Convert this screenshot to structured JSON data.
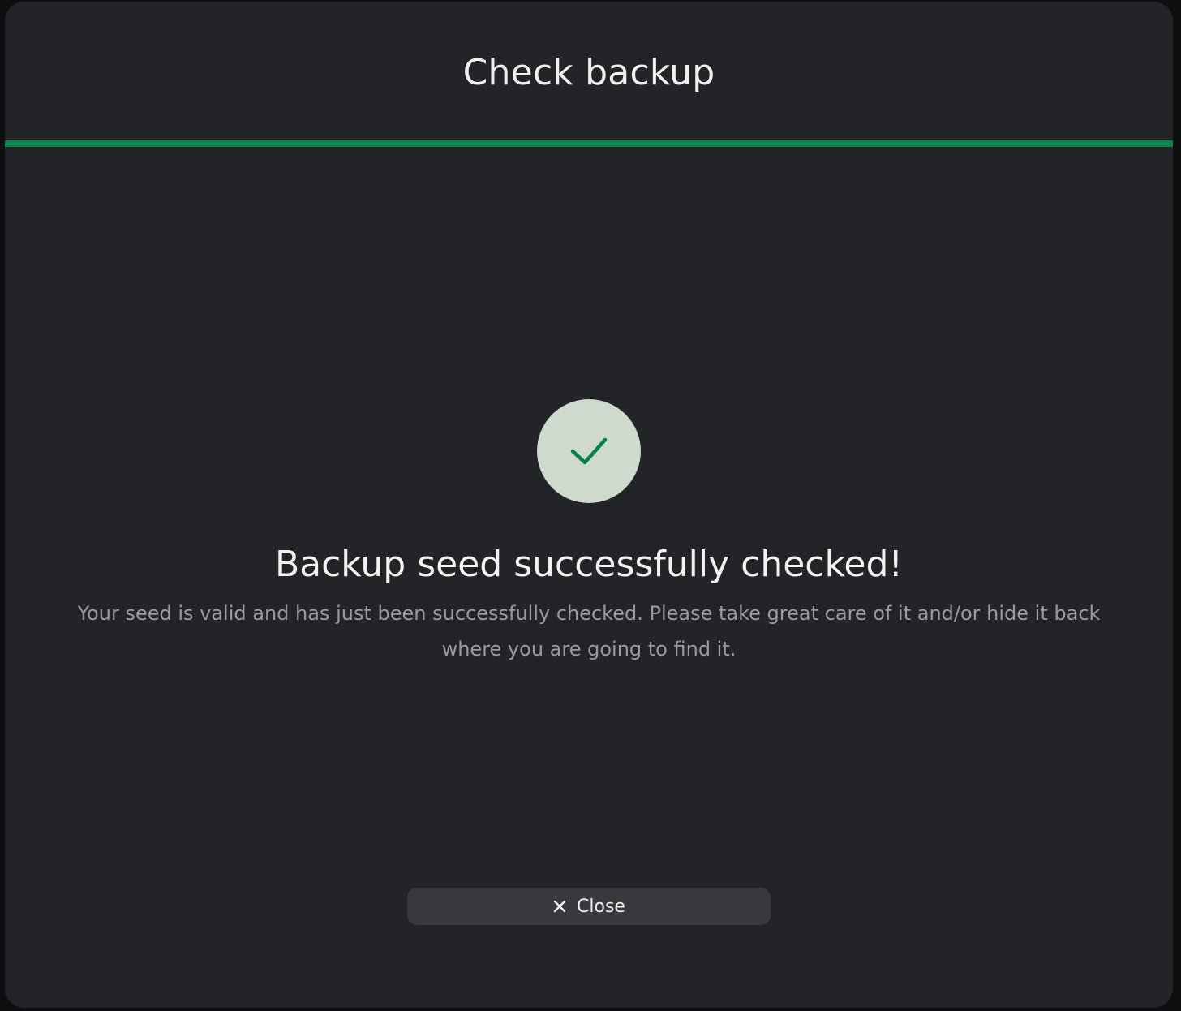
{
  "dialog": {
    "title": "Check backup",
    "progress": 1.0
  },
  "success": {
    "icon": "check-icon",
    "heading": "Backup seed successfully checked!",
    "description": "Your seed is valid and has just been successfully checked. Please take great care of it and/or hide it back where you are going to find it."
  },
  "actions": {
    "close_label": "Close",
    "close_icon": "close-icon"
  },
  "colors": {
    "accent": "#06864a",
    "success_circle": "#cedacd",
    "background": "#232427"
  }
}
